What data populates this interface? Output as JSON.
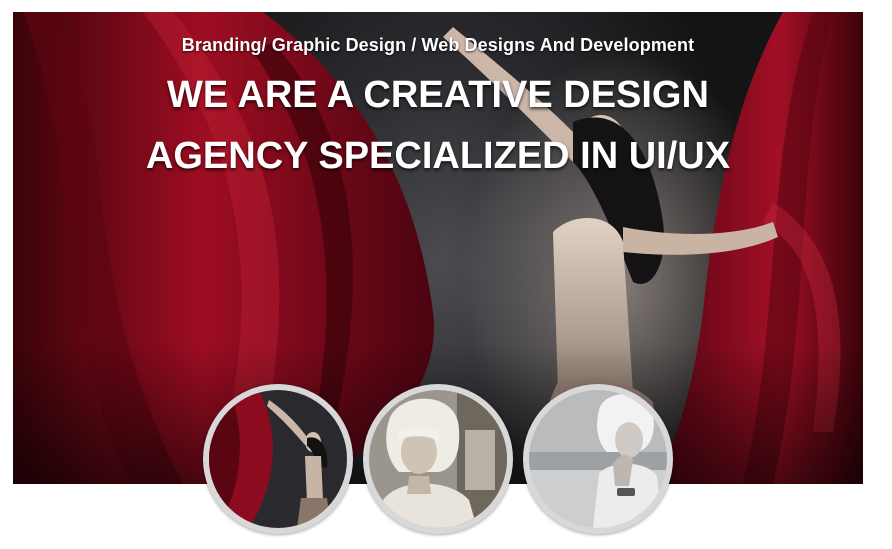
{
  "hero": {
    "tagline": "Branding/ Graphic Design / Web Designs And Development",
    "headline_line1": "WE ARE A CREATIVE DESIGN",
    "headline_line2": "AGENCY SPECIALIZED IN UI/UX"
  },
  "thumbnails": [
    {
      "name": "dancer-red-curtain-photo"
    },
    {
      "name": "blonde-woman-portrait-photo"
    },
    {
      "name": "woman-beach-bw-photo"
    }
  ],
  "colors": {
    "curtain_red": "#8a0a1c",
    "background_dark": "#1a1a1c",
    "text": "#ffffff",
    "thumb_ring": "#d8d8d8"
  }
}
